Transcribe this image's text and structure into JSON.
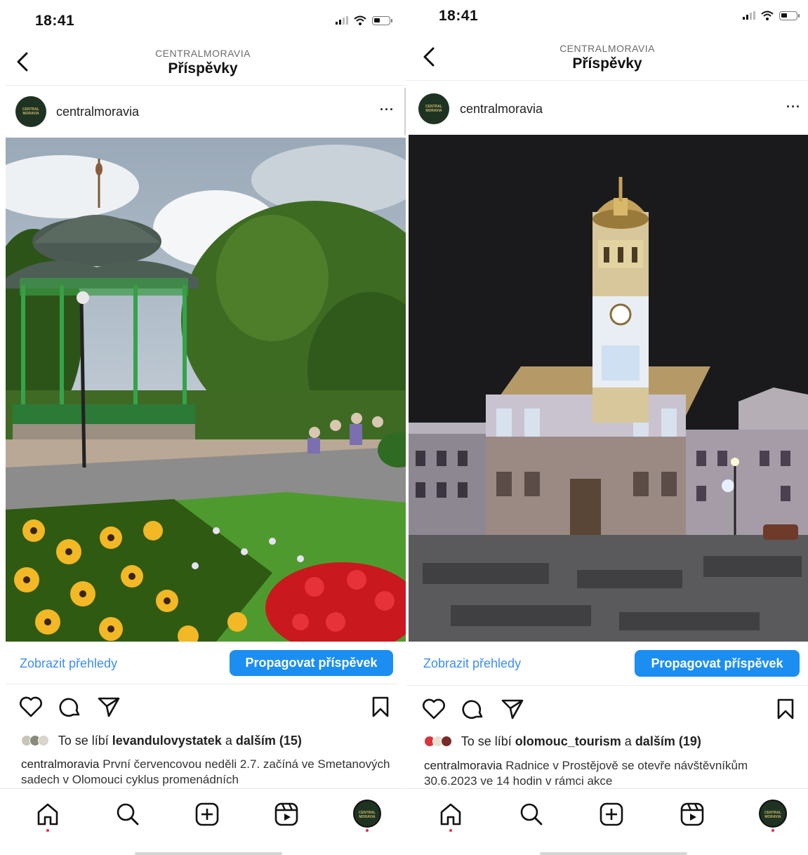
{
  "colors": {
    "accent": "#1c8ef1",
    "link": "#3b8ff0",
    "notification_dot": "#ef2a4a"
  },
  "left": {
    "status": {
      "time": "18:41"
    },
    "header": {
      "account": "CENTRALMORAVIA",
      "title": "Příspěvky"
    },
    "post": {
      "username": "centralmoravia",
      "more": "···",
      "insights_label": "Zobrazit přehledy",
      "promote_label": "Propagovat příspěvek",
      "likes_prefix": "To se líbí",
      "likes_user": "levandulovystatek",
      "likes_join": "a",
      "likes_others": "dalším (15)",
      "caption_user": "centralmoravia",
      "caption_text": "První červencovou neděli 2.7. začíná ve Smetanových sadech v Olomouci cyklus promenádních"
    }
  },
  "right": {
    "status": {
      "time": "18:41"
    },
    "header": {
      "account": "CENTRALMORAVIA",
      "title": "Příspěvky"
    },
    "post": {
      "username": "centralmoravia",
      "more": "···",
      "insights_label": "Zobrazit přehledy",
      "promote_label": "Propagovat příspěvek",
      "likes_prefix": "To se líbí",
      "likes_user": "olomouc_tourism",
      "likes_join": "a",
      "likes_others": "dalším (19)",
      "caption_user": "centralmoravia",
      "caption_text": "Radnice v Prostějově se otevře návštěvníkům 30.6.2023 ve 14 hodin v rámci akce"
    }
  },
  "avatar_text": "CENTRAL MORAVIA",
  "icons": [
    "chevron-left-icon",
    "heart-icon",
    "comment-icon",
    "send-icon",
    "bookmark-icon",
    "home-icon",
    "search-icon",
    "add-icon",
    "reels-icon",
    "profile-avatar"
  ]
}
